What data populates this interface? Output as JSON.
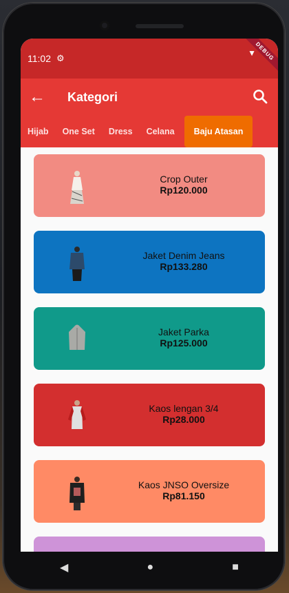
{
  "status": {
    "time": "11:02",
    "debug_label": "DEBUG"
  },
  "appbar": {
    "title": "Kategori"
  },
  "tabs": [
    {
      "label": "Hijab"
    },
    {
      "label": "One Set"
    },
    {
      "label": "Dress"
    },
    {
      "label": "Celana"
    },
    {
      "label": "Baju Atasan"
    }
  ],
  "products": [
    {
      "name": "Crop Outer",
      "price": "Rp120.000",
      "color": "#f28b82"
    },
    {
      "name": "Jaket Denim Jeans",
      "price": "Rp133.280",
      "color": "#0d74c1"
    },
    {
      "name": "Jaket Parka",
      "price": "Rp125.000",
      "color": "#109a8a"
    },
    {
      "name": "Kaos lengan 3/4",
      "price": "Rp28.000",
      "color": "#d32f2f"
    },
    {
      "name": "Kaos JNSO Oversize",
      "price": "Rp81.150",
      "color": "#ff8a65"
    },
    {
      "name": "",
      "price": "",
      "color": "#ce93d8"
    }
  ],
  "colors": {
    "statusbar": "#c62828",
    "appbar": "#e53935",
    "active_tab": "#ef6c00"
  }
}
